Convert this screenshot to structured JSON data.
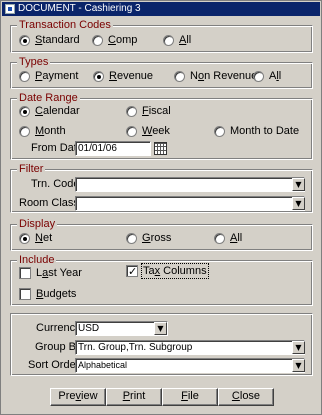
{
  "window": {
    "title": "DOCUMENT - Cashiering 3"
  },
  "transaction_codes": {
    "legend": "Transaction Codes",
    "options": [
      {
        "pre": "",
        "u": "S",
        "post": "tandard",
        "selected": true
      },
      {
        "pre": "",
        "u": "C",
        "post": "omp",
        "selected": false
      },
      {
        "pre": "",
        "u": "A",
        "post": "ll",
        "selected": false
      }
    ]
  },
  "types": {
    "legend": "Types",
    "options": [
      {
        "pre": "",
        "u": "P",
        "post": "ayment",
        "selected": false
      },
      {
        "pre": "",
        "u": "R",
        "post": "evenue",
        "selected": true
      },
      {
        "pre": "N",
        "u": "o",
        "post": "n Revenue",
        "selected": false
      },
      {
        "pre": "A",
        "u": "l",
        "post": "l",
        "selected": false
      }
    ]
  },
  "date_range": {
    "legend": "Date Range",
    "options": [
      {
        "pre": "",
        "u": "C",
        "post": "alendar",
        "selected": true
      },
      {
        "pre": "",
        "u": "F",
        "post": "iscal",
        "selected": false
      },
      {
        "pre": "",
        "u": "M",
        "post": "onth",
        "selected": false
      },
      {
        "pre": "",
        "u": "W",
        "post": "eek",
        "selected": false
      },
      {
        "pre": "",
        "u": "",
        "post": "Month to Date",
        "selected": false
      }
    ],
    "from_date_label": "From Date",
    "from_date_value": "01/01/06"
  },
  "filter": {
    "legend": "Filter",
    "trn_code_label": "Trn. Code",
    "trn_code_value": "",
    "room_class_label": "Room Class",
    "room_class_value": ""
  },
  "display": {
    "legend": "Display",
    "options": [
      {
        "pre": "",
        "u": "N",
        "post": "et",
        "selected": true
      },
      {
        "pre": "",
        "u": "G",
        "post": "ross",
        "selected": false
      },
      {
        "pre": "",
        "u": "A",
        "post": "ll",
        "selected": false
      }
    ]
  },
  "include": {
    "legend": "Include",
    "options": [
      {
        "pre": "L",
        "u": "a",
        "post": "st Year",
        "checked": false
      },
      {
        "pre": "Ta",
        "u": "x",
        "post": " Columns",
        "checked": true
      },
      {
        "pre": "",
        "u": "B",
        "post": "udgets",
        "checked": false
      }
    ]
  },
  "settings": {
    "currency_label": "Currency",
    "currency_value": "USD",
    "group_by_label": "Group By",
    "group_by_value": "Trn. Group,Trn. Subgroup",
    "sort_order_label": "Sort Order",
    "sort_order_value": "Alphabetical"
  },
  "buttons": [
    {
      "pre": "Pre",
      "u": "v",
      "post": "iew"
    },
    {
      "pre": "",
      "u": "P",
      "post": "rint"
    },
    {
      "pre": "",
      "u": "F",
      "post": "ile"
    },
    {
      "pre": "",
      "u": "C",
      "post": "lose"
    }
  ],
  "icons": {
    "dropdown": "down-arrow-icon",
    "calendar": "calendar-icon",
    "app": "document-app-icon"
  },
  "colors": {
    "title_bar": "#0a246a",
    "legend_text": "#7a0000",
    "window_bg": "#d4d0c8"
  }
}
